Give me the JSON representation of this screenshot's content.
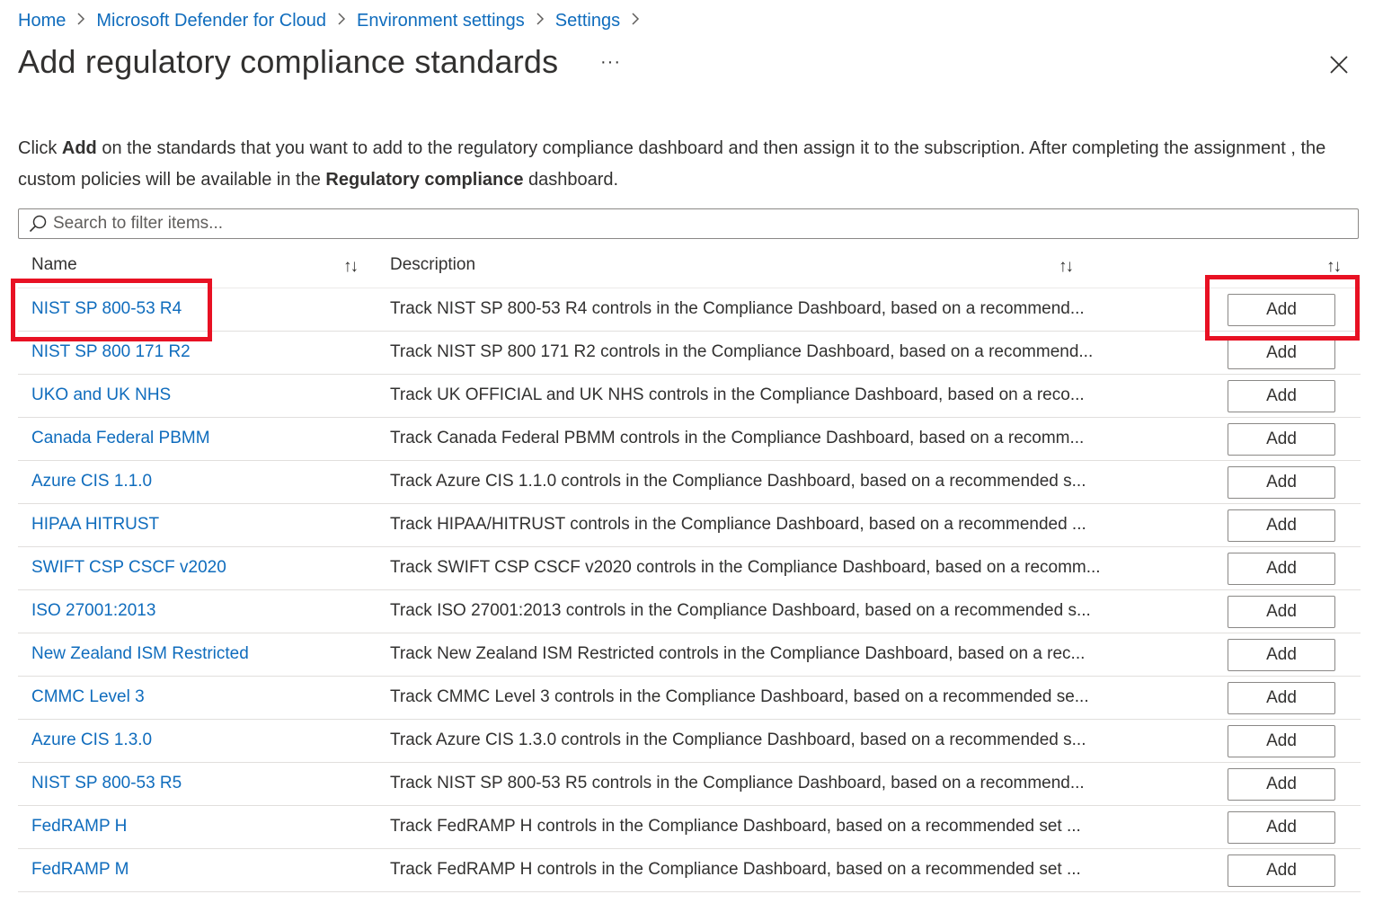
{
  "breadcrumb": {
    "items": [
      "Home",
      "Microsoft Defender for Cloud",
      "Environment settings",
      "Settings"
    ]
  },
  "header": {
    "title": "Add regulatory compliance standards",
    "more_label": "···"
  },
  "intro": {
    "part1": "Click ",
    "bold1": "Add",
    "part2": " on the standards that you want to add to the regulatory compliance dashboard and then assign it to the subscription. After completing the assignment , the custom policies will be available in the ",
    "bold2": "Regulatory compliance",
    "part3": " dashboard."
  },
  "search": {
    "placeholder": "Search to filter items..."
  },
  "table": {
    "columns": {
      "name": "Name",
      "description": "Description",
      "sort_glyph": "↑↓"
    },
    "rows": [
      {
        "name": "NIST SP 800-53 R4",
        "description": "Track NIST SP 800-53 R4 controls in the Compliance Dashboard, based on a recommend...",
        "action": "Add"
      },
      {
        "name": "NIST SP 800 171 R2",
        "description": "Track NIST SP 800 171 R2 controls in the Compliance Dashboard, based on a recommend...",
        "action": "Add"
      },
      {
        "name": "UKO and UK NHS",
        "description": "Track UK OFFICIAL and UK NHS controls in the Compliance Dashboard, based on a reco...",
        "action": "Add"
      },
      {
        "name": "Canada Federal PBMM",
        "description": "Track Canada Federal PBMM controls in the Compliance Dashboard, based on a recomm...",
        "action": "Add"
      },
      {
        "name": "Azure CIS 1.1.0",
        "description": "Track Azure CIS 1.1.0 controls in the Compliance Dashboard, based on a recommended s...",
        "action": "Add"
      },
      {
        "name": "HIPAA HITRUST",
        "description": "Track HIPAA/HITRUST controls in the Compliance Dashboard, based on a recommended ...",
        "action": "Add"
      },
      {
        "name": "SWIFT CSP CSCF v2020",
        "description": "Track SWIFT CSP CSCF v2020 controls in the Compliance Dashboard, based on a recomm...",
        "action": "Add"
      },
      {
        "name": "ISO 27001:2013",
        "description": "Track ISO 27001:2013 controls in the Compliance Dashboard, based on a recommended s...",
        "action": "Add"
      },
      {
        "name": "New Zealand ISM Restricted",
        "description": "Track New Zealand ISM Restricted controls in the Compliance Dashboard, based on a rec...",
        "action": "Add"
      },
      {
        "name": "CMMC Level 3",
        "description": "Track CMMC Level 3 controls in the Compliance Dashboard, based on a recommended se...",
        "action": "Add"
      },
      {
        "name": "Azure CIS 1.3.0",
        "description": "Track Azure CIS 1.3.0 controls in the Compliance Dashboard, based on a recommended s...",
        "action": "Add"
      },
      {
        "name": "NIST SP 800-53 R5",
        "description": "Track NIST SP 800-53 R5 controls in the Compliance Dashboard, based on a recommend...",
        "action": "Add"
      },
      {
        "name": "FedRAMP H",
        "description": "Track FedRAMP H controls in the Compliance Dashboard, based on a recommended set ...",
        "action": "Add"
      },
      {
        "name": "FedRAMP M",
        "description": "Track FedRAMP H controls in the Compliance Dashboard, based on a recommended set ...",
        "action": "Add"
      }
    ]
  },
  "colors": {
    "link": "#0f6cbd",
    "text": "#323130",
    "highlight": "#e81123",
    "border": "#8a8886"
  },
  "icons": {
    "breadcrumb_separator": "chevron-right-icon",
    "close": "close-icon",
    "search": "search-icon",
    "sort": "sort-icon"
  }
}
